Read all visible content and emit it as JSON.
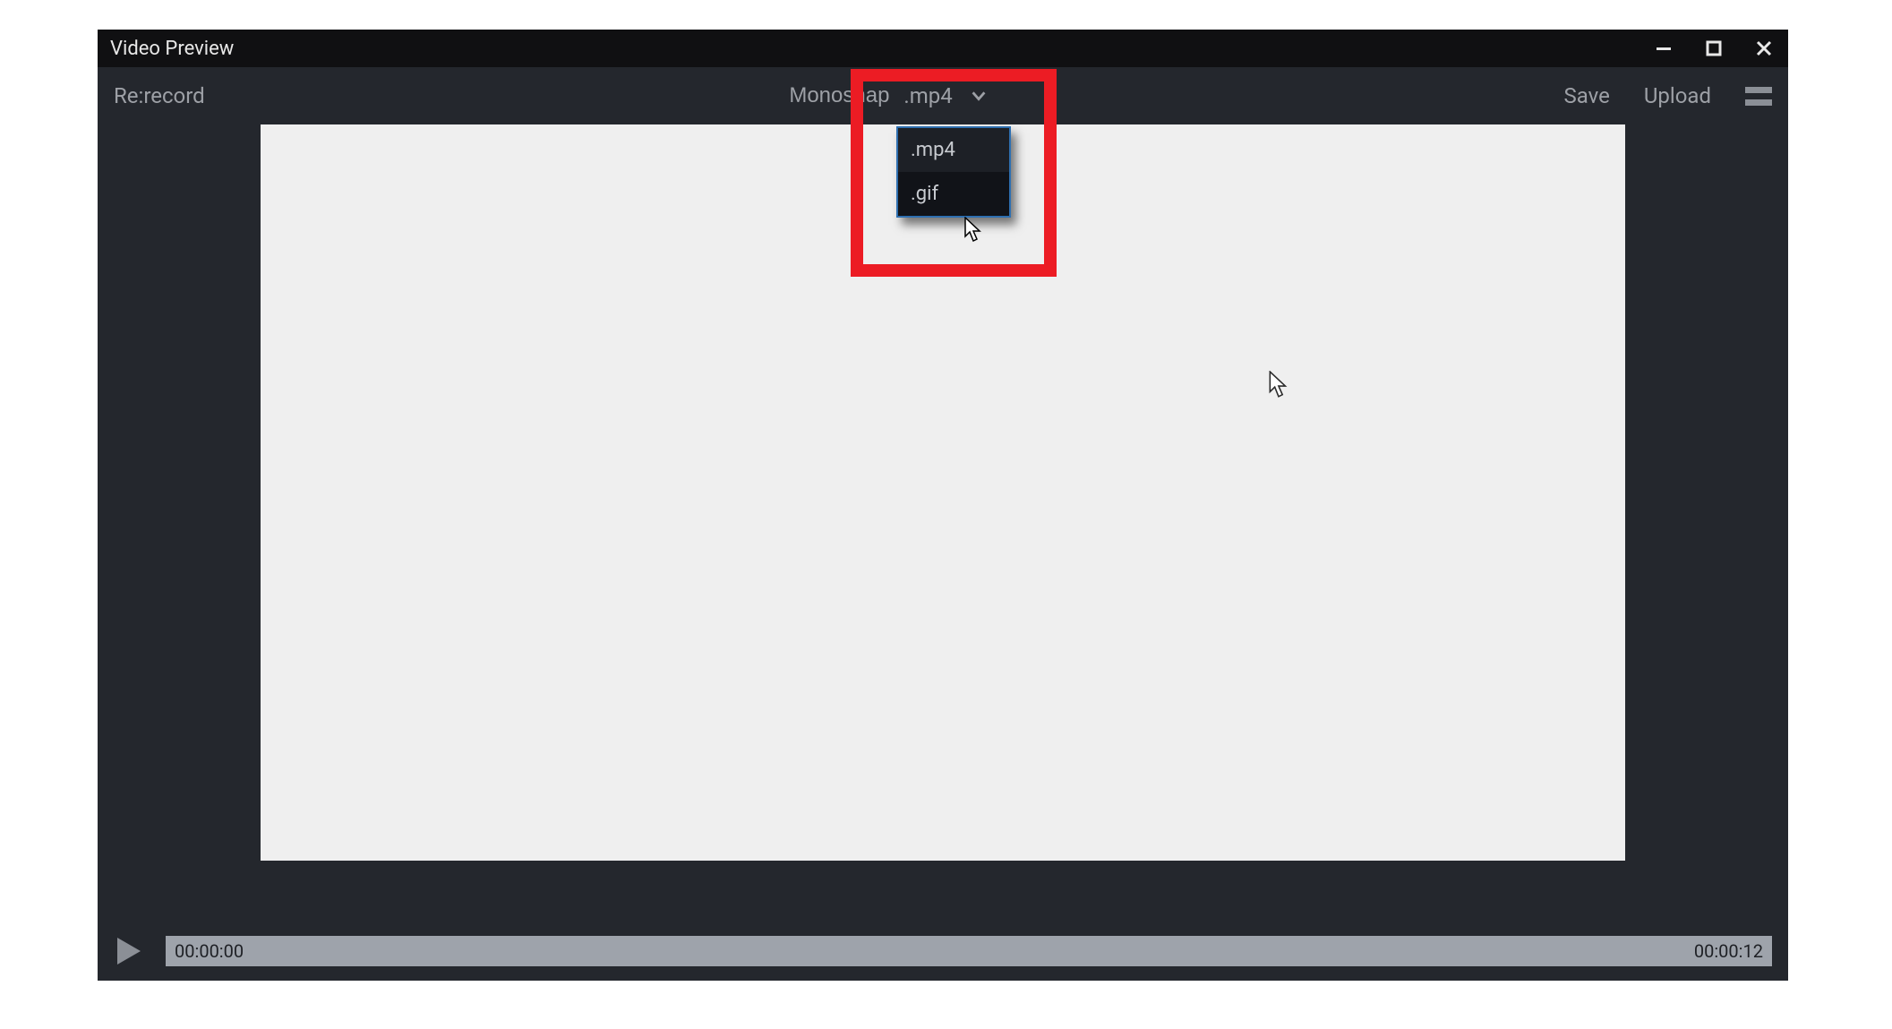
{
  "titlebar": {
    "title": "Video Preview"
  },
  "toolbar": {
    "rerecord_label": "Re:record",
    "filename": "Monosnap",
    "format_selected": ".mp4",
    "format_options": [
      ".mp4",
      ".gif"
    ],
    "save_label": "Save",
    "upload_label": "Upload"
  },
  "playbar": {
    "current_time": "00:00:00",
    "total_time": "00:00:12"
  },
  "icons": {
    "minimize": "minimize-icon",
    "maximize": "maximize-icon",
    "close": "close-icon",
    "chevron_down": "chevron-down-icon",
    "hamburger": "hamburger-icon",
    "play": "play-icon",
    "cursor": "cursor-icon"
  }
}
